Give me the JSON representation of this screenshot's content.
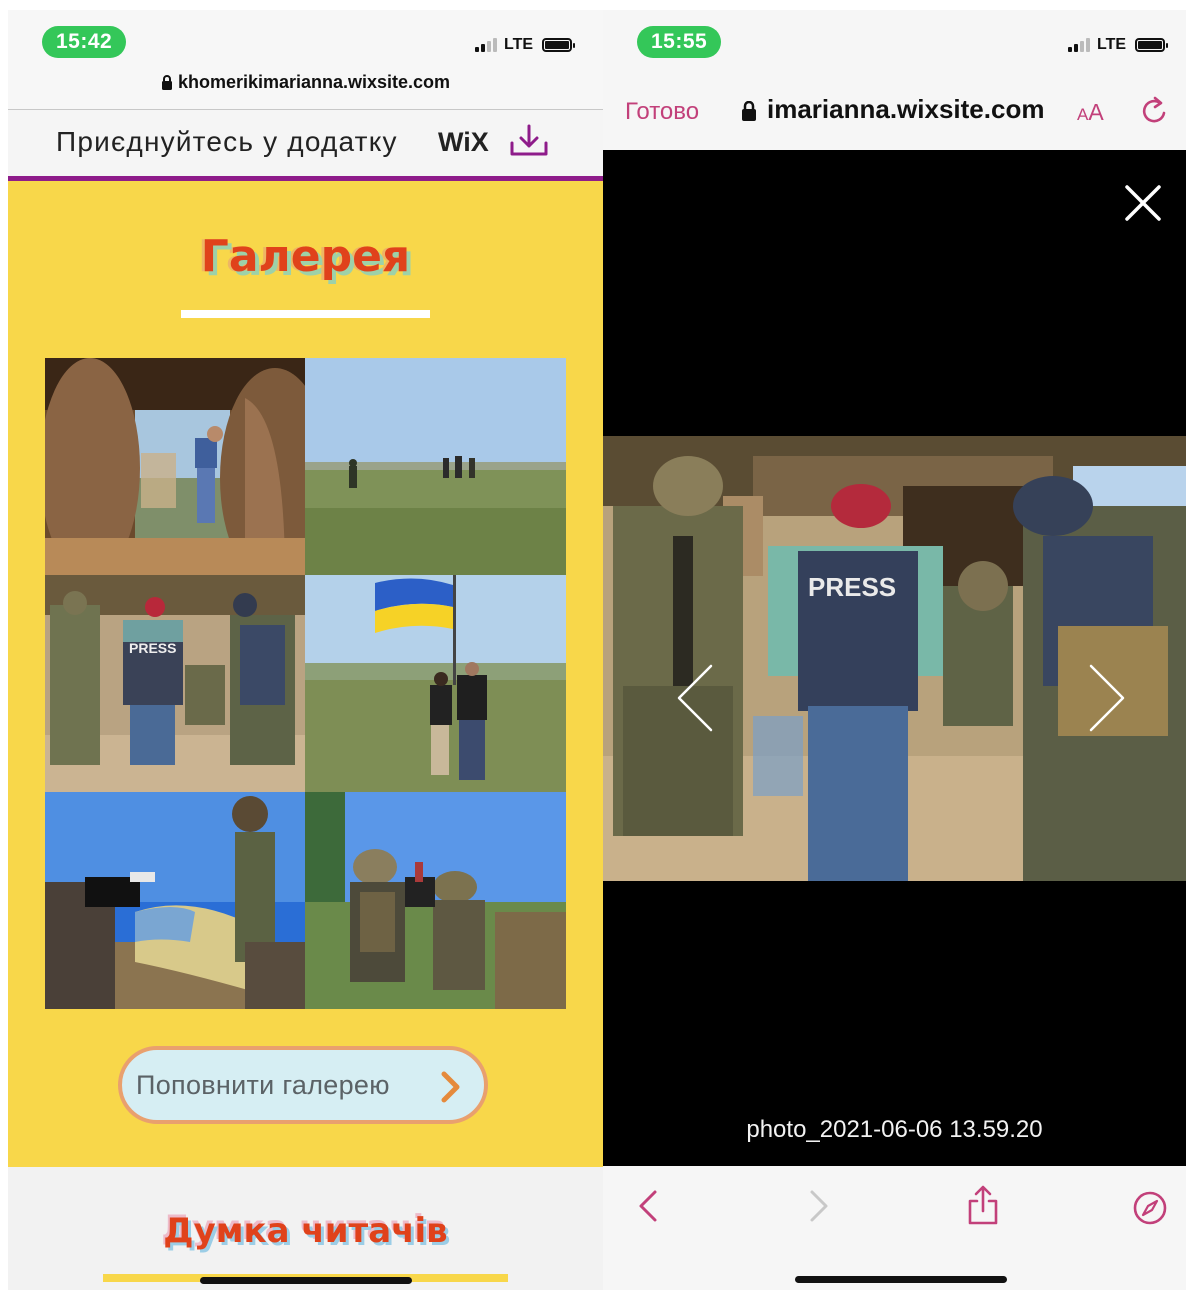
{
  "left_screen": {
    "status": {
      "time": "15:42",
      "network": "LTE"
    },
    "browser": {
      "url": "khomerikimarianna.wixsite.com"
    },
    "app_banner": {
      "text": "Приєднуйтесь у додатку",
      "brand": "WiX"
    },
    "gallery": {
      "title": "Галерея",
      "photos": [
        "trench-doorway",
        "field-walk",
        "press-group",
        "ukrainian-flag",
        "camera-flag",
        "helmets-trench"
      ],
      "add_button": "Поповнити галерею"
    },
    "readers": {
      "title": "Думка читачів"
    }
  },
  "right_screen": {
    "status": {
      "time": "15:55",
      "network": "LTE"
    },
    "browser": {
      "done": "Готово",
      "url_faded": "",
      "url": "imarianna.wixsite.com",
      "text_size_small": "A",
      "text_size_big": "A"
    },
    "viewer": {
      "caption": "photo_2021-06-06 13.59.20",
      "press_label": "PRESS"
    }
  },
  "colors": {
    "gallery_bg": "#f8d74a",
    "title_orange": "#e0421b",
    "banner_purple": "#8e1c8a",
    "safari_pink": "#c2407a",
    "status_green": "#34c759",
    "button_bg": "#d6eef3",
    "button_border": "#e9a06e"
  },
  "icons": [
    "lock-icon",
    "download-icon",
    "chevron-right-icon",
    "close-icon",
    "chevron-left-icon",
    "reload-icon",
    "share-icon",
    "compass-icon"
  ]
}
